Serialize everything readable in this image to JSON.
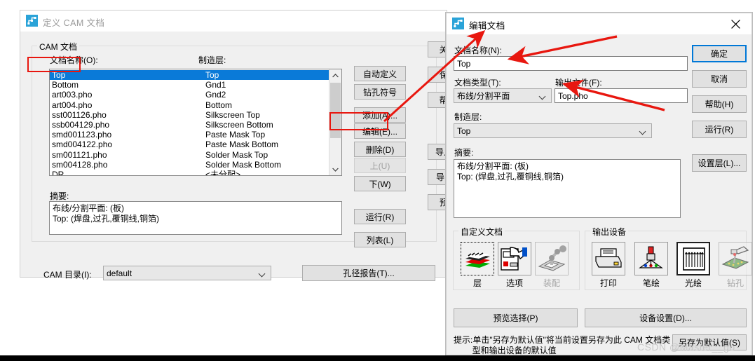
{
  "colors": {
    "accent": "#0078d7",
    "selection": "#0a7ad8",
    "annotation_red": "#e8170f",
    "dialog_face": "#f0f0f0",
    "title_icon_blue": "#2aa3d8"
  },
  "define_cam_dialog": {
    "title": "定义 CAM 文档",
    "icon": "pads-cam-icon",
    "group_cam_document": {
      "legend": "CAM 文档",
      "label_document_name": "文档名称(O):",
      "label_manufacturing_layer": "制造层:",
      "list": {
        "columns": [
          "文档名称",
          "制造层"
        ],
        "rows": [
          {
            "name": "Top",
            "layer": "Top",
            "selected": true
          },
          {
            "name": "Bottom",
            "layer": "Gnd1",
            "selected": false
          },
          {
            "name": "art003.pho",
            "layer": "Gnd2",
            "selected": false
          },
          {
            "name": "art004.pho",
            "layer": "Bottom",
            "selected": false
          },
          {
            "name": "sst001126.pho",
            "layer": "Silkscreen Top",
            "selected": false
          },
          {
            "name": "ssb004129.pho",
            "layer": "Silkscreen Bottom",
            "selected": false
          },
          {
            "name": "smd001123.pho",
            "layer": "Paste Mask Top",
            "selected": false
          },
          {
            "name": "smd004122.pho",
            "layer": "Paste Mask Bottom",
            "selected": false
          },
          {
            "name": "sm001121.pho",
            "layer": "Solder Mask Top",
            "selected": false
          },
          {
            "name": "sm004128.pho",
            "layer": "Solder Mask Bottom",
            "selected": false
          },
          {
            "name": "DR",
            "layer": "<未分配>",
            "selected": false
          }
        ]
      },
      "label_summary": "摘要:",
      "summary_text": "布线/分割平面: (板)\nTop: (焊盘,过孔,覆铜线,铜箔)"
    },
    "list_buttons": [
      {
        "label": "自动定义",
        "name": "auto-define-button",
        "disabled": false
      },
      {
        "label": "钻孔符号",
        "name": "drill-symbol-button",
        "disabled": false
      },
      {
        "label": "添加(A)...",
        "name": "add-button",
        "disabled": false
      },
      {
        "label": "编辑(E)...",
        "name": "edit-button",
        "disabled": false,
        "highlighted": true
      },
      {
        "label": "删除(D)",
        "name": "delete-button",
        "disabled": false
      },
      {
        "label": "上(U)",
        "name": "move-up-button",
        "disabled": true
      },
      {
        "label": "下(W)",
        "name": "move-down-button",
        "disabled": false
      },
      {
        "label": "运行(R)",
        "name": "run-button",
        "disabled": false
      },
      {
        "label": "列表(L)",
        "name": "list-button",
        "disabled": false
      }
    ],
    "side_buttons": [
      {
        "label": "关闭(C)",
        "name": "close-button"
      },
      {
        "label": "保存(S)",
        "name": "save-button"
      },
      {
        "label": "帮助(H)",
        "name": "help-button"
      },
      {
        "label": "导入(M)...",
        "name": "import-button"
      },
      {
        "label": "导出(X)...",
        "name": "export-button"
      },
      {
        "label": "预览(V)",
        "name": "preview-button"
      }
    ],
    "footer": {
      "label_cam_directory": "CAM 目录(I):",
      "cam_directory_value": "default",
      "drill_report_button": "孔径报告(T)..."
    }
  },
  "edit_document_dialog": {
    "title": "编辑文档",
    "icon": "pads-cam-icon",
    "close_icon": "close-icon",
    "label_document_name": "文档名称(N):",
    "document_name_value": "Top",
    "label_document_type": "文档类型(T):",
    "document_type_value": "布线/分割平面",
    "label_output_file": "输出文件(F):",
    "output_file_value": "Top.pho",
    "label_manufacturing_layer": "制造层:",
    "manufacturing_layer_value": "Top",
    "label_summary": "摘要:",
    "summary_text": "布线/分割平面: (板)\nTop: (焊盘,过孔,覆铜线,铜箔)",
    "group_custom_document": {
      "legend": "自定义文档",
      "tiles": [
        {
          "caption": "层",
          "name": "layers-tile",
          "icon": "layer-stack-icon",
          "state": "focused"
        },
        {
          "caption": "选项",
          "name": "options-tile",
          "icon": "hand-document-icon",
          "state": "normal"
        },
        {
          "caption": "装配",
          "name": "assembly-tile",
          "icon": "robot-arm-icon",
          "state": "disabled"
        }
      ]
    },
    "group_output_device": {
      "legend": "输出设备",
      "tiles": [
        {
          "caption": "打印",
          "name": "print-tile",
          "icon": "printer-icon",
          "state": "normal"
        },
        {
          "caption": "笔绘",
          "name": "penplot-tile",
          "icon": "pen-plotter-icon",
          "state": "normal"
        },
        {
          "caption": "光绘",
          "name": "photoplot-tile",
          "icon": "photoplot-icon",
          "state": "selected"
        },
        {
          "caption": "钻孔",
          "name": "drill-tile",
          "icon": "drill-icon",
          "state": "disabled"
        }
      ]
    },
    "side_buttons": [
      {
        "label": "确定",
        "name": "ok-button",
        "default": true
      },
      {
        "label": "取消",
        "name": "cancel-button",
        "default": false
      },
      {
        "label": "帮助(H)",
        "name": "help-button",
        "default": false
      },
      {
        "label": "运行(R)",
        "name": "run-button",
        "default": false
      },
      {
        "label": "设置层(L)...",
        "name": "setup-layers-button",
        "default": false
      }
    ],
    "preview_selection_button": "预览选择(P)",
    "device_setup_button": "设备设置(D)...",
    "save_as_default_button": "另存为默认值(S)",
    "tip_text": "提示:单击\"另存为默认值\"将当前设置另存为此 CAM 文档类\n        型和输出设备的默认值"
  },
  "watermark": "CSDN @Master__go"
}
